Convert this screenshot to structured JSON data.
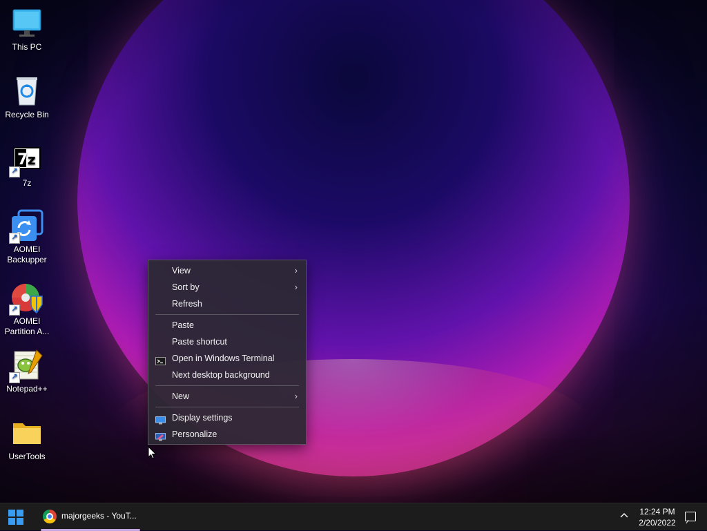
{
  "desktop": {
    "icons": [
      {
        "label": "This PC"
      },
      {
        "label": "Recycle Bin"
      },
      {
        "label": "7z"
      },
      {
        "label": "AOMEI Backupper"
      },
      {
        "label": "AOMEI Partition A..."
      },
      {
        "label": "Notepad++"
      },
      {
        "label": "UserTools"
      }
    ]
  },
  "context_menu": {
    "items": [
      {
        "label": "View",
        "has_submenu": true
      },
      {
        "label": "Sort by",
        "has_submenu": true
      },
      {
        "label": "Refresh"
      },
      {
        "label": "Paste"
      },
      {
        "label": "Paste shortcut"
      },
      {
        "label": "Open in Windows Terminal",
        "icon": "terminal-icon"
      },
      {
        "label": "Next desktop background"
      },
      {
        "label": "New",
        "has_submenu": true
      },
      {
        "label": "Display settings",
        "icon": "display-icon"
      },
      {
        "label": "Personalize",
        "icon": "personalize-icon"
      }
    ],
    "submenu_arrow": "›"
  },
  "taskbar": {
    "active_app_label": "majorgeeks - YouT...",
    "tray_chevron": "^",
    "time": "12:24 PM",
    "date": "2/20/2022"
  },
  "colors": {
    "accent_start": "#3a9cf0",
    "menu_bg": "#2c2834",
    "taskbar_bg": "#1c1c1c"
  }
}
